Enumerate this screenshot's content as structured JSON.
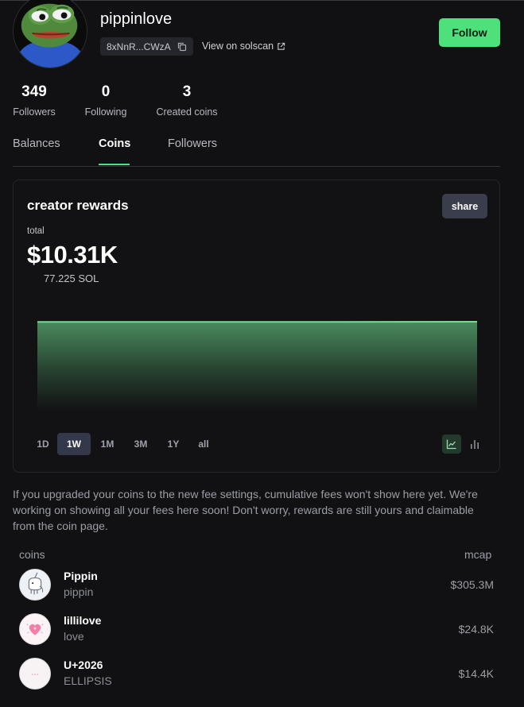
{
  "profile": {
    "username": "pippinlove",
    "address_short": "8xNnR...CWzA",
    "solscan_label": "View on solscan",
    "follow_label": "Follow"
  },
  "stats": [
    {
      "value": "349",
      "label": "Followers"
    },
    {
      "value": "0",
      "label": "Following"
    },
    {
      "value": "3",
      "label": "Created coins"
    }
  ],
  "tabs": [
    {
      "label": "Balances",
      "active": false
    },
    {
      "label": "Coins",
      "active": true
    },
    {
      "label": "Followers",
      "active": false
    }
  ],
  "rewards": {
    "title": "creator rewards",
    "share_label": "share",
    "total_label": "total",
    "total_value": "$10.31K",
    "sol_value": "77.225 SOL",
    "ranges": [
      "1D",
      "1W",
      "1M",
      "3M",
      "1Y",
      "all"
    ],
    "active_range": "1W",
    "chart_types": [
      "line-chart-icon",
      "bar-chart-icon"
    ],
    "active_chart_type": "line-chart-icon",
    "accent_color": "#4ee07a"
  },
  "chart_data": {
    "type": "area",
    "series": [
      {
        "values": [
          10.28,
          10.28,
          10.29,
          10.29,
          10.29,
          10.3,
          10.31
        ]
      }
    ],
    "grid": false,
    "legend": "none"
  },
  "notice": "If you upgraded your coins to the new fee settings, cumulative fees won't show here yet. We're working on showing all your fees here soon! Don't worry, rewards are still yours and claimable from the coin page.",
  "coins_list": {
    "header_left": "coins",
    "header_right": "mcap",
    "items": [
      {
        "name": "Pippin",
        "ticker": "pippin",
        "mcap": "$305.3M",
        "icon": "pippin-unicorn-icon"
      },
      {
        "name": "lillilove",
        "ticker": "love",
        "mcap": "$24.8K",
        "icon": "heart-icon"
      },
      {
        "name": "U+2026",
        "ticker": "ELLIPSIS",
        "mcap": "$14.4K",
        "icon": "ellipsis-icon"
      }
    ]
  }
}
